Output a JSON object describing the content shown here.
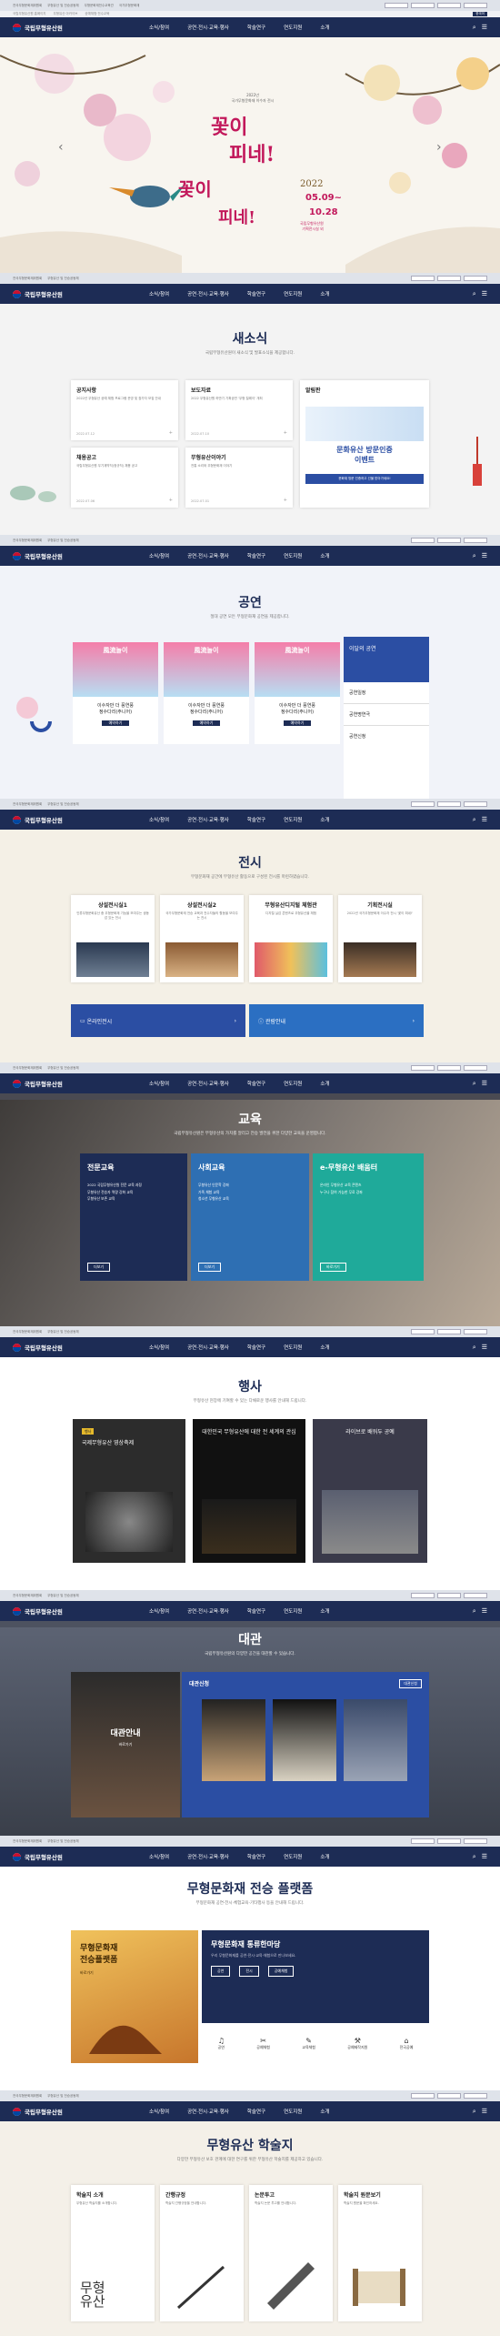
{
  "utility": {
    "links": [
      "전국무형문화재위원회",
      "무형유산 및 전승공동체",
      "무형문화재전수교육관",
      "국가무형문화재",
      "전통공연예술",
      "전통공예"
    ],
    "sublinks": [
      "국립무형유산원 홈페이지",
      "무형유산 아카이브",
      "공예체험·전수교육",
      "예약 안내"
    ],
    "lang": "한국어",
    "banner": "문화재청 바로가기"
  },
  "nav": {
    "logo": "국립무형유산원",
    "menu": [
      "소식/참여",
      "공연·전시·교육·행사",
      "학술연구",
      "연도지원",
      "소개"
    ]
  },
  "hero": {
    "kicker": "2022년\n국가무형문화재 이수자 전시",
    "title1": "꽃이",
    "title2": "피네!",
    "title3": "꽃이",
    "title4": "피네!",
    "year": "2022",
    "dates": "05.09~",
    "dates2": "10.28",
    "venue": "국립무형유산원\n기획전시실 외"
  },
  "news": {
    "title": "새소식",
    "subtitle": "국립무형유산원이 새소식 및 발표소식을 제공합니다.",
    "cards": [
      {
        "title": "공지사항",
        "desc": "2022년 무형유산 공예 체험 프로그램 운영 및 참가자 모집 안내",
        "date": "2022.07.12"
      },
      {
        "title": "보도자료",
        "desc": "2022 무형유산원 하반기 기획공연 '무형 릴레이' 개최",
        "date": "2022.07.10"
      },
      {
        "title": "채용공고",
        "desc": "국립무형유산원 무기계약직(정규직) 채용 공고",
        "date": "2022.07.06"
      },
      {
        "title": "무형유산이야기",
        "desc": "전통 소리와 무형문화재 이야기",
        "date": "2022.07.01"
      }
    ],
    "popup": {
      "title": "알림판",
      "line1": "문화유산 방문인증",
      "line2": "이벤트",
      "footer": "문화재 방문 인증하고 선물 받아가세요!"
    }
  },
  "perf": {
    "title": "공연",
    "subtitle": "절대 공연 모든 무형문화재 공연을 제공합니다.",
    "items": [
      {
        "poster": "風流놀이",
        "name": "이수자만 더 풍연풍",
        "sub": "정수다리(주니어)"
      },
      {
        "poster": "風流놀이",
        "name": "이수자만 더 풍연풍",
        "sub": "정수다리(주니어)"
      },
      {
        "poster": "風流놀이",
        "name": "이수자만 더 풍연풍",
        "sub": "정수다리(주니어)"
      }
    ],
    "btn": "예약하기",
    "side": {
      "head": "이달의 공연",
      "items": [
        "공연일정",
        "공연명연극",
        "공연신청"
      ]
    }
  },
  "exhib": {
    "title": "전시",
    "subtitle": "무형문화재 공간에 무형유산 활동으로 구성된 전시를 마련하였습니다.",
    "cards": [
      {
        "title": "상설전시실1",
        "desc": "인류무형문화유산 중 무형문화재 기능을 보여주는 생동감 있는 전시"
      },
      {
        "title": "상설전시실2",
        "desc": "국가무형문화재 전승 교육과 전수자들의 활동을 보여주는 전시"
      },
      {
        "title": "무형유산디지털 체험관",
        "desc": "디지털 실감 콘텐츠로 무형유산을 체험"
      },
      {
        "title": "기획전시실",
        "desc": "2022년 국가무형문화재 이수자 전시 '꽃이 피네!'"
      }
    ],
    "btn1": "온라인전시",
    "btn1sub": "무형유산 온라인 전시관",
    "btn2": "관람안내",
    "btn2sub": "관람시간 및 예약 안내"
  },
  "edu": {
    "title": "교육",
    "subtitle": "국립무형유산원은 무형유산의 가치를 알리고 전승 발전을 위한 다양한 교육을 운영합니다.",
    "cards": [
      {
        "title": "전문교육",
        "items": [
          "2022 국립무형유산원 전문 교육 과정",
          "무형유산 전승자 역량 강화 교육",
          "무형유산 보존 교육"
        ],
        "btn": "더보기"
      },
      {
        "title": "사회교육",
        "items": [
          "무형유산 인문학 강좌",
          "가족 체험 교육",
          "청소년 무형유산 교육"
        ],
        "btn": "더보기"
      },
      {
        "title": "e-무형유산 배움터",
        "items": [
          "온라인 무형유산 교육 콘텐츠",
          "누구나 참여 가능한 무료 강좌"
        ],
        "btn": "바로가기"
      }
    ]
  },
  "event": {
    "title": "행사",
    "subtitle": "무형유산 현장에 기여할 수 있는 다채로운 행사를 안내해 드립니다.",
    "cards": [
      {
        "title": "국제무형유산 영상축제",
        "tag": "행사"
      },
      {
        "title": "대한민국 무형유산에 대한 전 세계의 관심",
        "tag": "행사"
      },
      {
        "title": "라이브로 배워두 공예",
        "tag": "행사"
      }
    ]
  },
  "hall": {
    "title": "대관",
    "subtitle": "국립무형유산원의 다양한 공간을 대관할 수 있습니다.",
    "left": "대관안내",
    "left_btn": "바로가기",
    "mid": "대관신청",
    "right_btn": "대관신청"
  },
  "platform": {
    "title": "무형문화재 전승 플랫폼",
    "subtitle": "무형문화재 공연·전시·체험교육·기타행사 등을 안내해 드립니다.",
    "left": "무형문화재\n전승플랫폼",
    "left_btn": "바로가기",
    "right_title": "무형문화재 통류한마당",
    "right_desc": "우리 무형문화재를 공연·전시·교육·체험으로 만나보세요.",
    "btns": [
      "공연",
      "전시",
      "공예체험"
    ],
    "icons": [
      "공연",
      "공예체험",
      "교육체험",
      "공예제작지원",
      "전국공예"
    ]
  },
  "journal": {
    "title": "무형유산 학술지",
    "subtitle": "다양한 무형유산 보호 관계에 대한 연구를 위한 무형유산 학술지를 제공하고 있습니다.",
    "cards": [
      {
        "title": "학술지 소개",
        "desc": "무형유산 학술지를 소개합니다."
      },
      {
        "title": "간행규정",
        "desc": "학술지 간행규정을 안내합니다."
      },
      {
        "title": "논문투고",
        "desc": "학술지 논문 투고를 안내합니다."
      },
      {
        "title": "학술지 원문보기",
        "desc": "학술지 원문을 확인하세요."
      }
    ],
    "art": "무형\n유산"
  },
  "colors": {
    "navy": "#1d2c55",
    "blue": "#2b4ea3",
    "teal": "#1faa9a"
  }
}
